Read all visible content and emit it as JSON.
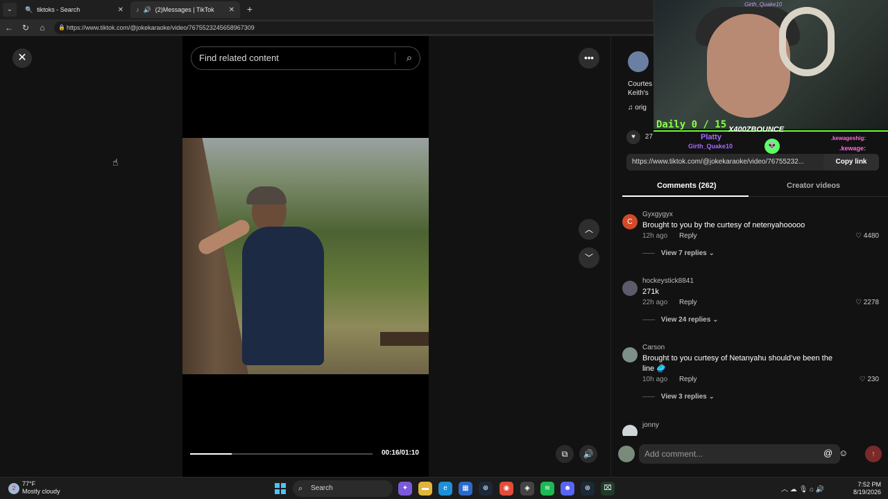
{
  "browser": {
    "tabs": [
      {
        "label": "tiktoks - Search",
        "icon": "search-icon"
      },
      {
        "label": "(2)Messages | TikTok",
        "icon": "tiktok-icon"
      }
    ],
    "new_tab": "+",
    "url": "https://www.tiktok.com/@jokekaraoke/video/7675523245658967309"
  },
  "video": {
    "search_placeholder": "Find related content",
    "time": "00:16/01:10",
    "progress": 0.23
  },
  "post": {
    "desc_line1": "Courtes",
    "desc_line2": "Keith's",
    "music": "orig",
    "likes": "27",
    "link": "https://www.tiktok.com/@jokekaraoke/video/76755232...",
    "copy_link": "Copy link"
  },
  "tabs": {
    "comments": "Comments (262)",
    "creator_videos": "Creator videos"
  },
  "comments": [
    {
      "initial": "C",
      "user": "Gyxgygyx",
      "text": "Brought to you by the curtesy of netenyahooooo",
      "time": "12h ago",
      "reply": "Reply",
      "likes": "4480",
      "replies": "View 7 replies",
      "avatar_color": "#d14a2a"
    },
    {
      "initial": "",
      "user": "hockeystick8841",
      "text": "271k",
      "time": "22h ago",
      "reply": "Reply",
      "likes": "2278",
      "replies": "View 24 replies",
      "avatar_color": "#5d5a6a"
    },
    {
      "initial": "",
      "user": "Carson",
      "text": "Brought to you curtesy of Netanyahu should’ve been the line 🥏",
      "time": "10h ago",
      "reply": "Reply",
      "likes": "230",
      "replies": "View 3 replies",
      "avatar_color": "#7d8f8a"
    },
    {
      "initial": "",
      "user": "jonny",
      "text": "",
      "time": "",
      "reply": "",
      "likes": "",
      "replies": "",
      "avatar_color": "#cfd6d8"
    }
  ],
  "add_comment": {
    "placeholder": "Add comment..."
  },
  "stream": {
    "cam_name": "Girth_Quake10",
    "daily": "Daily 0 / 15",
    "tag1": "X400ZBOUNCE",
    "tag2": "Platty",
    "tag3": "Girth_Quake10",
    "tag4": ".kewageshig:",
    "tag5": ".kewage:"
  },
  "taskbar": {
    "temp": "77°F",
    "weather": "Mostly cloudy",
    "search": "Search",
    "time": "7:52 PM",
    "date": "8/19/2026"
  }
}
